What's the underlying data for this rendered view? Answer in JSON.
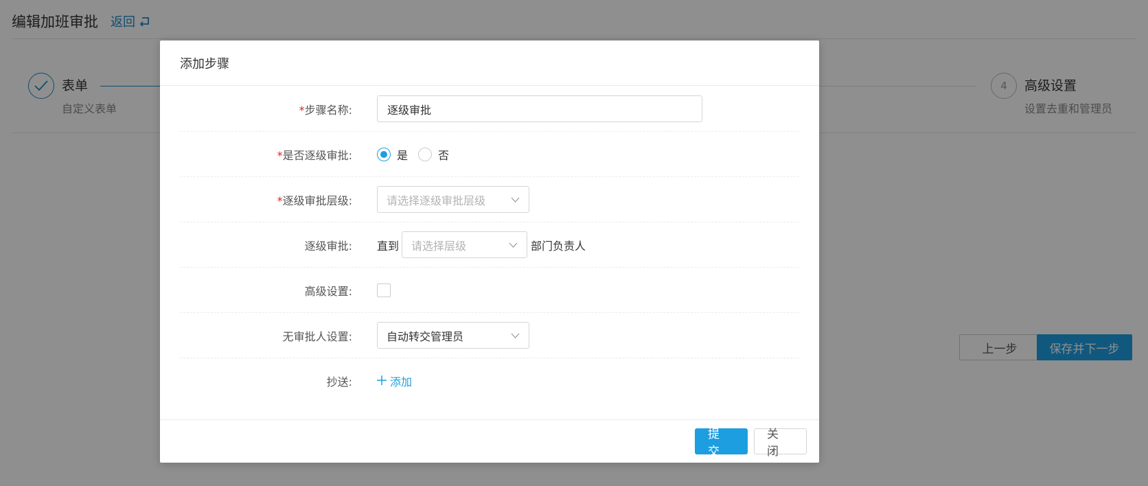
{
  "page": {
    "title": "编辑加班审批",
    "back_label": "返回",
    "steps": [
      {
        "number": "",
        "title": "表单",
        "desc": "自定义表单",
        "state": "done"
      },
      {
        "number": "4",
        "title": "高级设置",
        "desc": "设置去重和管理员",
        "state": "pending"
      }
    ],
    "prev_button": "上一步",
    "next_button": "保存并下一步"
  },
  "dialog": {
    "title": "添加步骤",
    "required_mark": "*",
    "fields": {
      "step_name": {
        "label": "步骤名称:",
        "value": "逐级审批"
      },
      "level_approval": {
        "label": "是否逐级审批:",
        "option_yes": "是",
        "option_no": "否",
        "selected": "是"
      },
      "approval_level": {
        "label": "逐级审批层级:",
        "placeholder": "请选择逐级审批层级"
      },
      "approval_until": {
        "label": "逐级审批:",
        "prefix": "直到",
        "placeholder": "请选择层级",
        "suffix": "部门负责人"
      },
      "advanced": {
        "label": "高级设置:",
        "checked": false
      },
      "no_approver": {
        "label": "无审批人设置:",
        "value": "自动转交管理员"
      },
      "cc": {
        "label": "抄送:",
        "add_label": "添加"
      }
    },
    "submit_label": "提交",
    "close_label": "关闭"
  },
  "colors": {
    "accent": "#1d9ee0",
    "link": "#1d8ac7",
    "required": "#e02020"
  }
}
